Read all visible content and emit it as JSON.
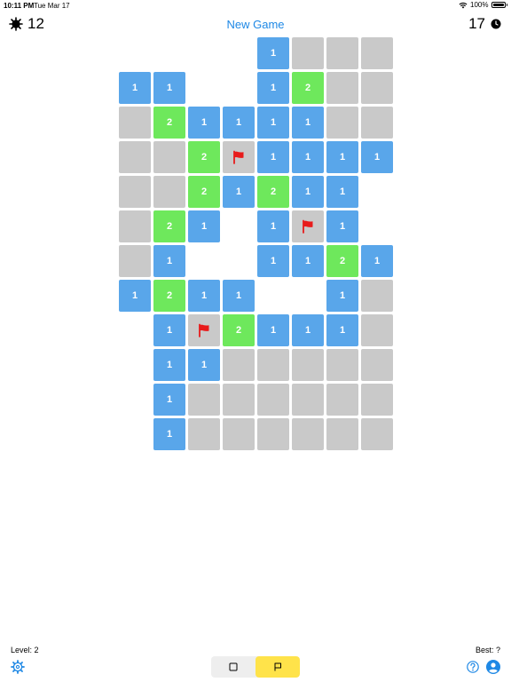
{
  "status_bar": {
    "time": "10:11 PM",
    "date": "Tue Mar 17",
    "battery": "100%"
  },
  "header": {
    "mines_remaining": "12",
    "new_game_label": "New Game",
    "elapsed": "17"
  },
  "board": {
    "columns": 8,
    "rows": 12,
    "cells": [
      [
        "",
        "",
        "",
        "",
        "b1",
        "g",
        "g",
        "g"
      ],
      [
        "b1",
        "b1",
        "",
        "",
        "b1",
        "G2",
        "g",
        "g"
      ],
      [
        "g",
        "G2",
        "b1",
        "b1",
        "b1",
        "b1",
        "g",
        "g"
      ],
      [
        "g",
        "g",
        "G2",
        "F",
        "b1",
        "b1",
        "b1",
        "b1"
      ],
      [
        "g",
        "g",
        "G2",
        "b1",
        "G2",
        "b1",
        "b1",
        ""
      ],
      [
        "g",
        "G2",
        "b1",
        "",
        "b1",
        "F",
        "b1",
        ""
      ],
      [
        "g",
        "b1",
        "",
        "",
        "b1",
        "b1",
        "G2",
        "b1"
      ],
      [
        "b1",
        "G2",
        "b1",
        "b1",
        "",
        "",
        "b1",
        "g"
      ],
      [
        "",
        "b1",
        "F",
        "G2",
        "b1",
        "b1",
        "b1",
        "g"
      ],
      [
        "",
        "b1",
        "b1",
        "g",
        "g",
        "g",
        "g",
        "g"
      ],
      [
        "",
        "b1",
        "g",
        "g",
        "g",
        "g",
        "g",
        "g"
      ],
      [
        "",
        "b1",
        "g",
        "g",
        "g",
        "g",
        "g",
        "g"
      ]
    ]
  },
  "footer": {
    "level_label": "Level: 2",
    "best_label": "Best: ?",
    "active_mode": "flag"
  },
  "colors": {
    "revealed_1": "#59a6ea",
    "revealed_2": "#6ee85c",
    "hidden": "#c9c9c9",
    "flag": "#e81b1b",
    "accent": "#1e88e5",
    "flag_mode_active": "#ffe34a"
  },
  "icons": {
    "mines": "mine-icon",
    "timer": "clock-icon",
    "settings": "gear-icon",
    "help": "help-icon",
    "account": "account-icon",
    "reveal_mode": "square-icon",
    "flag_mode": "flag-outline-icon",
    "status": [
      "wifi-icon",
      "battery-icon"
    ]
  }
}
